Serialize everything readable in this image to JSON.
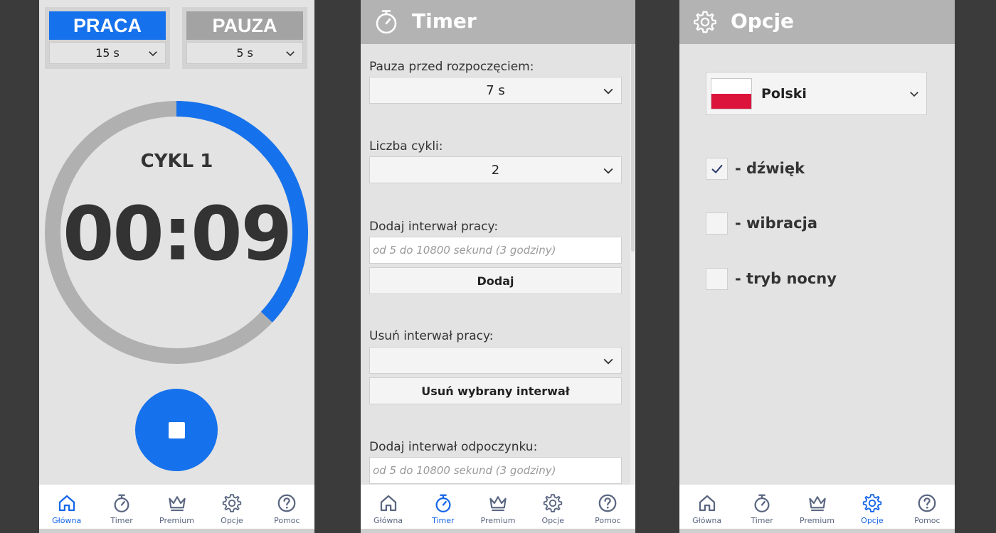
{
  "colors": {
    "accent": "#1672ec",
    "ring_track": "#b0b0b0",
    "header_bg": "#b3b3b3",
    "praca_bg": "#1672ec",
    "pauza_bg": "#a3a3a3"
  },
  "nav": {
    "items": [
      {
        "label": "Główna",
        "icon": "home-icon"
      },
      {
        "label": "Timer",
        "icon": "stopwatch-icon"
      },
      {
        "label": "Premium",
        "icon": "crown-icon"
      },
      {
        "label": "Opcje",
        "icon": "gear-icon"
      },
      {
        "label": "Pomoc",
        "icon": "help-icon"
      }
    ]
  },
  "main": {
    "work": {
      "title": "PRACA",
      "value": "15 s"
    },
    "pause": {
      "title": "PAUZA",
      "value": "5 s"
    },
    "cycle_label": "CYKL 1",
    "time": "00:09",
    "progress_fraction": 0.37,
    "active_nav": 0
  },
  "timer": {
    "title": "Timer",
    "pause_before": {
      "label": "Pauza przed rozpoczęciem:",
      "value": "7 s"
    },
    "cycles": {
      "label": "Liczba cykli:",
      "value": "2"
    },
    "add_work": {
      "label": "Dodaj interwał pracy:",
      "placeholder": "od 5 do 10800 sekund (3 godziny)",
      "button": "Dodaj"
    },
    "remove_work": {
      "label": "Usuń interwał pracy:",
      "value": "",
      "button": "Usuń wybrany interwał"
    },
    "add_rest": {
      "label": "Dodaj interwał odpoczynku:",
      "placeholder": "od 5 do 10800 sekund (3 godziny)"
    },
    "active_nav": 1
  },
  "options": {
    "title": "Opcje",
    "language": "Polski",
    "checks": [
      {
        "label": "- dźwięk",
        "checked": true
      },
      {
        "label": "- wibracja",
        "checked": false
      },
      {
        "label": "- tryb nocny",
        "checked": false
      }
    ],
    "active_nav": 3
  }
}
